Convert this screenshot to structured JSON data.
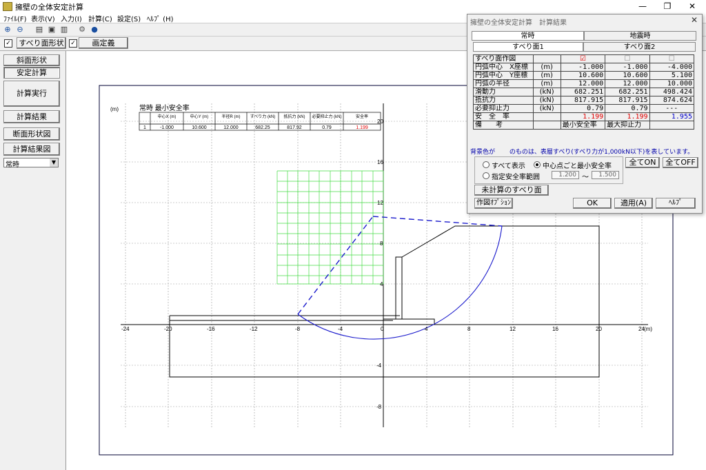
{
  "window": {
    "title": "擁壁の全体安定計算",
    "min": "—",
    "max": "❐",
    "close": "✕"
  },
  "menu": [
    "ﾌｧｲﾙ(F)",
    "表示(V)",
    "入力(I)",
    "計算(C)",
    "設定(S)",
    "ﾍﾙﾌﾟ (H)"
  ],
  "toolbar": {
    "icons": [
      "zoom-in-icon",
      "zoom-out-icon",
      "print-icon",
      "print-preview-icon",
      "printer-setup-icon",
      "gear-icon",
      "help-icon"
    ]
  },
  "checkbar": {
    "cb1": "✓",
    "slip_label": "すべり面形状",
    "cb2": "✓",
    "drawing_label": "画定義"
  },
  "left": {
    "btn_slope": "斜面形状",
    "btn_stability": "安定計算",
    "btn_run": "計算実行",
    "btn_result": "計算結果",
    "btn_section": "断面形状図",
    "btn_result_fig": "計算結果図",
    "select_value": "常時",
    "select_arrow": "▼"
  },
  "figure": {
    "unit_label": "(m)",
    "summary_title": "常時 最小安全率",
    "summary_headers": [
      "中心X\n(m)",
      "中心Y\n(m)",
      "半径R\n(m)",
      "すべり力\n(kN)",
      "抵抗力\n(kN)",
      "必要抑止力\n(kN)",
      "安全率"
    ],
    "summary_row": [
      "1",
      "-1.000",
      "10.600",
      "12.000",
      "682.25",
      "817.92",
      "0.79",
      "1.199"
    ],
    "x_ticks": [
      "-24",
      "-20",
      "-16",
      "-12",
      "-8",
      "-4",
      "0",
      "4",
      "8",
      "12",
      "16",
      "20",
      "24"
    ],
    "y_ticks": [
      "20",
      "16",
      "12",
      "8",
      "4",
      "0",
      "-4",
      "-8"
    ],
    "x_unit": "(m)",
    "y_unit": "(m)"
  },
  "dialog": {
    "title": "擁壁の全体安定計算　計算結果",
    "close": "✕",
    "tabs_top": [
      "常時",
      "地震時"
    ],
    "tabs_sub": [
      "すべり面1",
      "すべり面2"
    ],
    "rows": [
      {
        "label": "すべり面作図",
        "unit": "",
        "v": [
          "☑",
          "☐",
          "☐"
        ]
      },
      {
        "label": "円弧中心　X座標",
        "unit": "(m)",
        "v": [
          "-1.000",
          "-1.000",
          "-4.000"
        ]
      },
      {
        "label": "円弧中心　Y座標",
        "unit": "(m)",
        "v": [
          "10.600",
          "10.600",
          "5.100"
        ]
      },
      {
        "label": "円弧の半径",
        "unit": "(m)",
        "v": [
          "12.000",
          "12.000",
          "10.000"
        ]
      },
      {
        "label": "滑動力",
        "unit": "(kN)",
        "v": [
          "682.251",
          "682.251",
          "498.424"
        ]
      },
      {
        "label": "抵抗力",
        "unit": "(kN)",
        "v": [
          "817.915",
          "817.915",
          "874.624"
        ]
      },
      {
        "label": "必要抑止力",
        "unit": "(kN)",
        "v": [
          "0.79",
          "0.79",
          "---"
        ]
      },
      {
        "label": "安　全　率",
        "unit": "",
        "v": [
          "1.199",
          "1.199",
          "1.955"
        ]
      },
      {
        "label": "備　　考",
        "unit": "",
        "v": [
          "最小安全率",
          "最大抑止力",
          ""
        ]
      }
    ],
    "note": "背景色が　　 のものは、表層すべり(すべり力が1,000kN以下)を表しています。",
    "radio_all": "すべて表示",
    "radio_center": "中心点ごと最小安全率",
    "radio_range": "指定安全率範囲",
    "range_from": "1.200",
    "range_tilde": "～",
    "range_to": "1.500",
    "btn_all_on": "全てON",
    "btn_all_off": "全てOFF",
    "btn_uncalc": "未計算のすべり面",
    "btn_option": "作図ｵﾌﾟｼｮﾝ",
    "btn_ok": "OK",
    "btn_apply": "適用(A)",
    "btn_help": "ﾍﾙﾌﾟ",
    "colors": {
      "red": "#e00000",
      "blue": "#0000cc",
      "note_blue": "#0000aa"
    }
  }
}
